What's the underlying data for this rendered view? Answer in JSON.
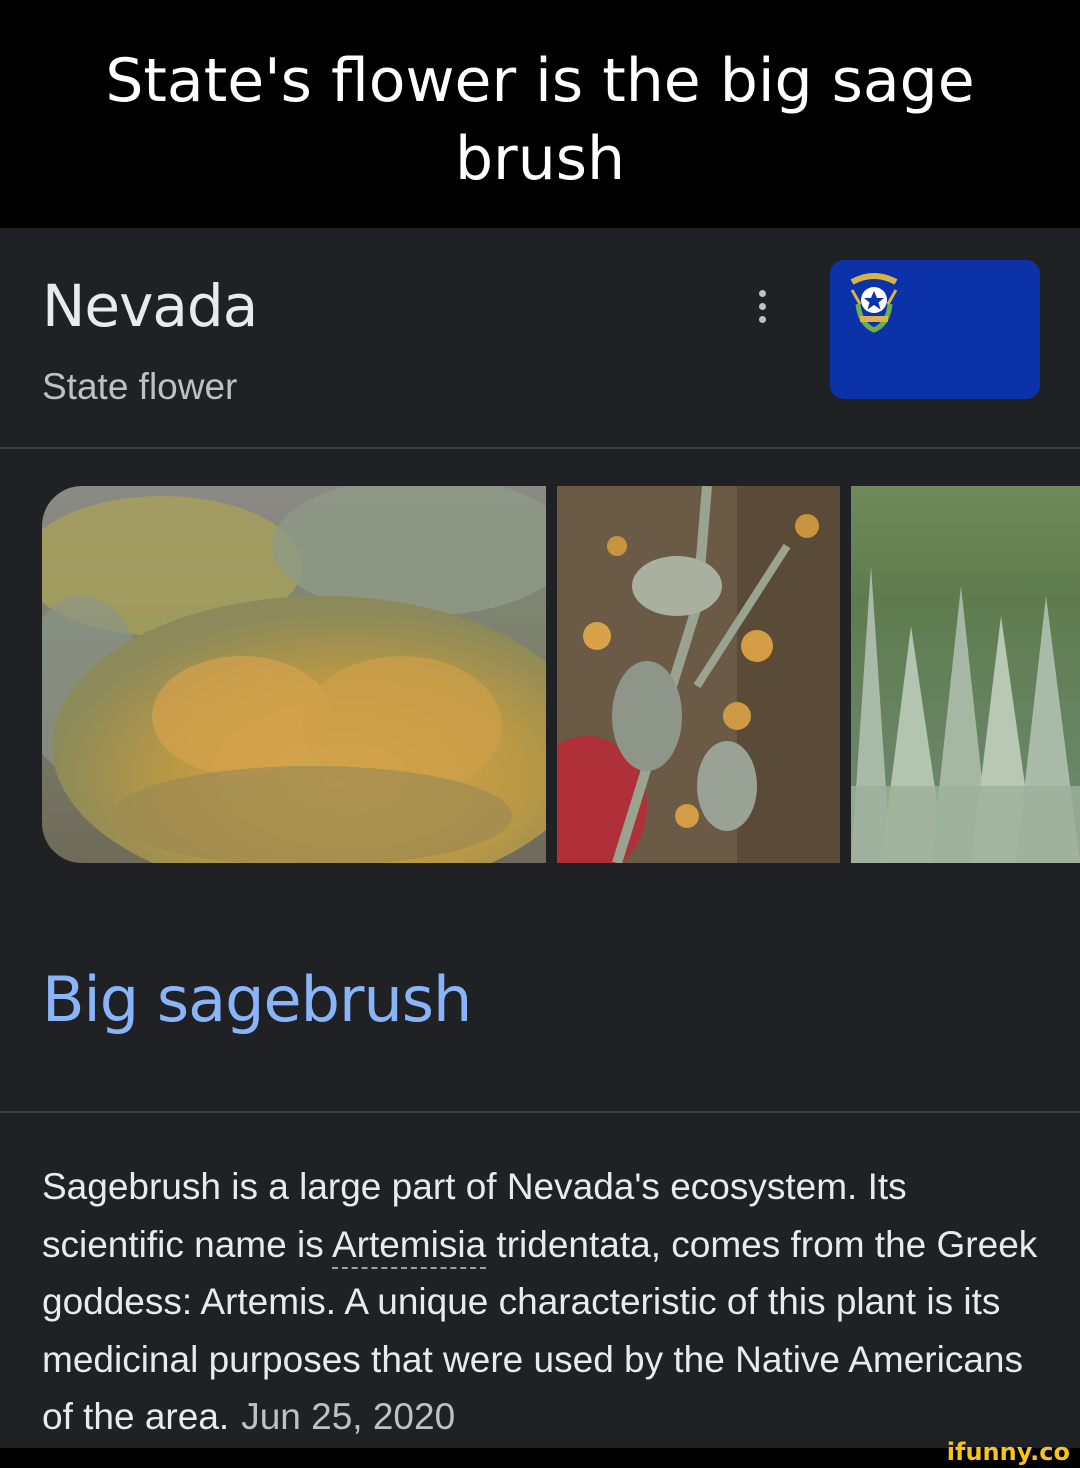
{
  "caption": {
    "line1": "State's flower is the big sage",
    "line2": "brush"
  },
  "panel": {
    "title": "Nevada",
    "subtitle": "State flower",
    "more_icon": "more-vert-icon",
    "flag_color": "#0b32a8"
  },
  "images": [
    "sagebrush-bush-photo",
    "sagebrush-closeup-photo",
    "sagebrush-field-photo"
  ],
  "entity": {
    "name": "Big sagebrush",
    "link_color": "#8ab4f8"
  },
  "description": {
    "before": "Sagebrush is a large part of Nevada's ecosystem. Its scientific name is ",
    "term": "Artemisia",
    "after": " tridentata, comes from the Greek goddess: Artemis. A unique characteristic of this plant is its medicinal purposes that were used by the Native Americans of the area.",
    "date": "Jun 25, 2020"
  },
  "watermark": "ifunny.co"
}
